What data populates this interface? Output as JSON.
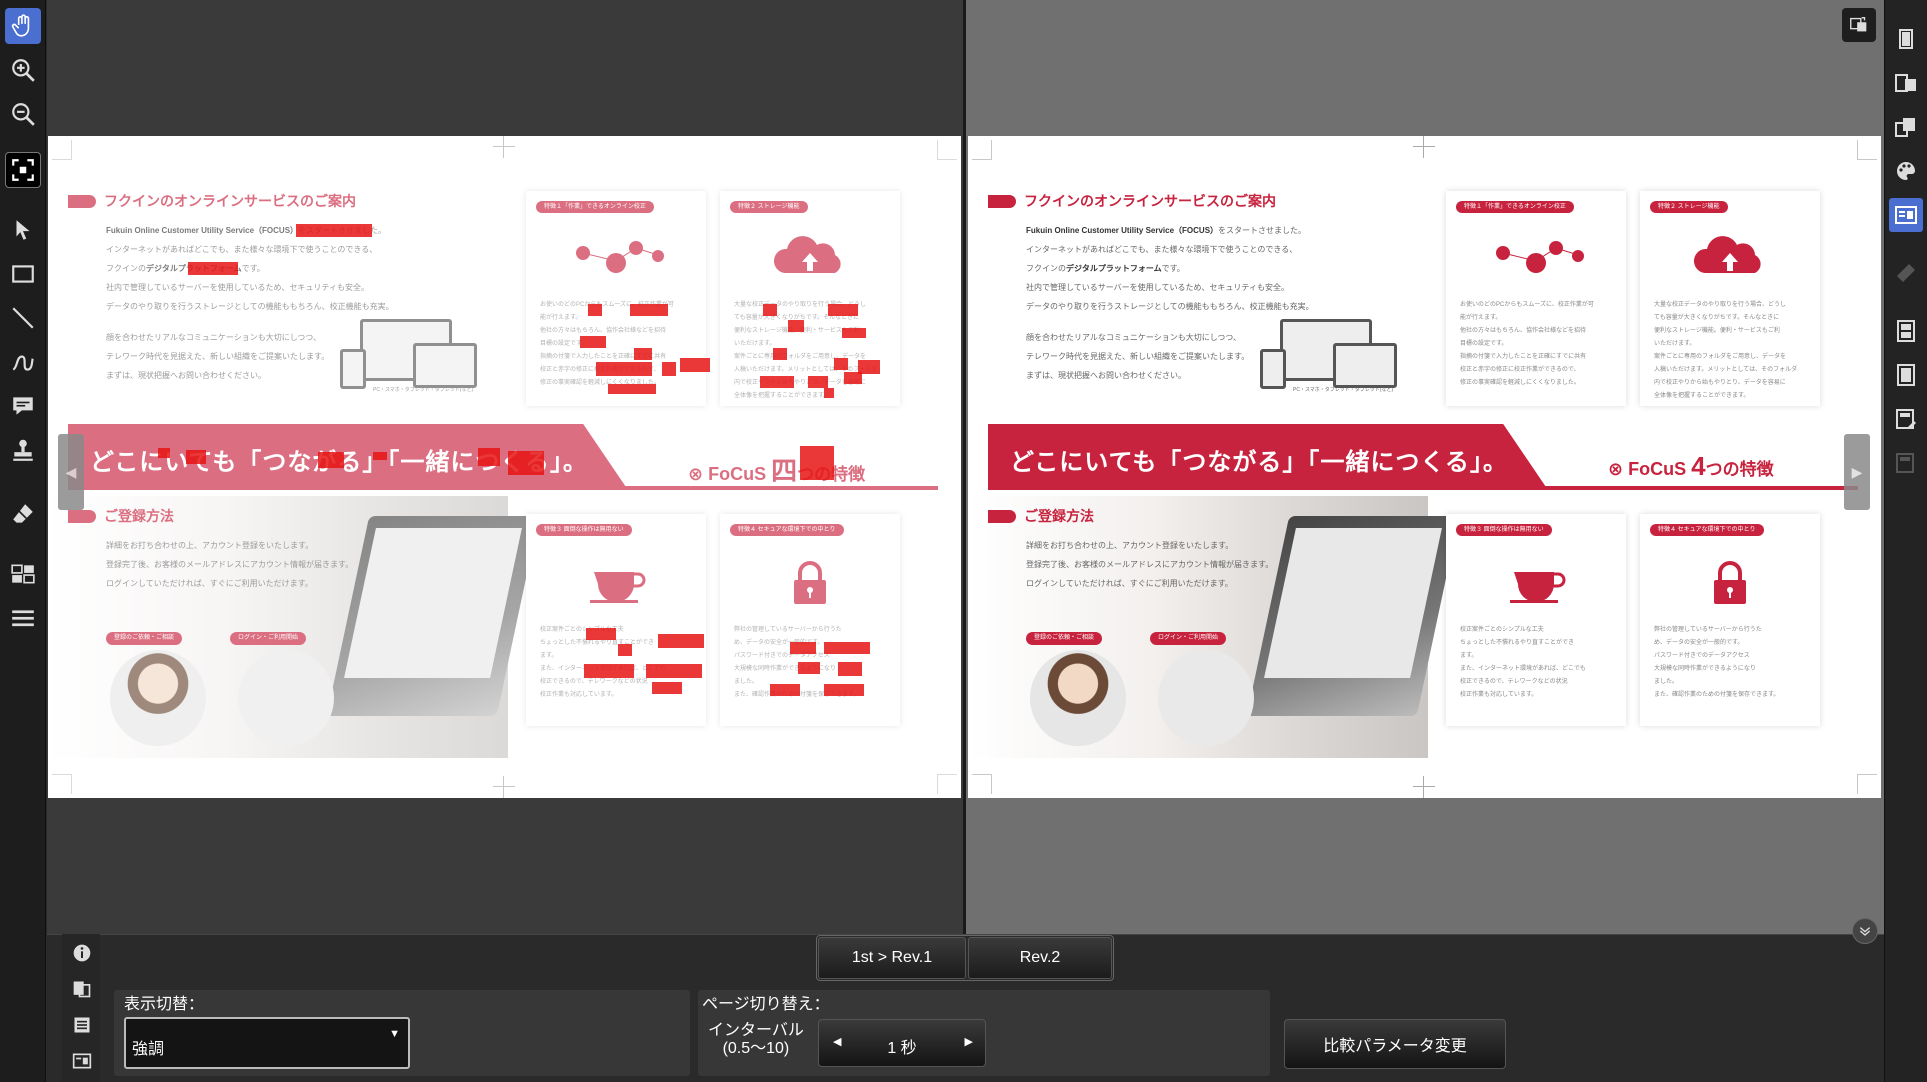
{
  "left_toolbar": {
    "tools": [
      "hand-icon",
      "zoom-in-icon",
      "zoom-out-icon",
      "fit-page-icon",
      "select-arrow-icon",
      "rectangle-icon",
      "line-icon",
      "freehand-icon",
      "comment-icon",
      "stamp-icon",
      "eraser-icon",
      "grid-icon",
      "menu-icon"
    ],
    "active_tool": "hand-icon"
  },
  "document": {
    "section1_title": "フクインのオンラインサービスのご案内",
    "intro_line1_prefix": "Fukuin Online Customer Utility Service（FOCUS）",
    "intro_line1_suffix": "をスタートさせました。",
    "intro_line2": "インターネットがあればどこでも、また様々な環境下で使うことのできる、",
    "intro_line3_prefix": "フクインの",
    "intro_line3_bold": "デジタルプラットフォーム",
    "intro_line3_suffix": "です。",
    "intro_line4": "社内で管理しているサーバーを使用しているため、セキュリティも安全。",
    "intro_line5": "データのやり取りを行うストレージとしての機能ももちろん、校正機能も充実。",
    "intro_line6": "顔を合わせたリアルなコミュニケーションも大切にしつつ、",
    "intro_line7": "テレワーク時代を見据えた、新しい組織をご提案いたします。",
    "intro_line8": "まずは、現状把握へお問い合わせください。",
    "feature1_pill": "特徴１「作業」できるオンライン校正",
    "feature2_pill": "特徴２ ストレージ機能",
    "feature3_pill": "特徴３ 面倒な操作は無用ない",
    "feature4_pill": "特徴４ セキュアな環境下での中とり",
    "feature1_lines": [
      "お使いのどのPCからもスムーズに、校正作業が可",
      "能が行えます。",
      "他社の方々はもちろん、協作会社様などを招待",
      "目標の設定です。",
      "指摘の付箋で入力したことを正確にすでに共有",
      "校正と赤字の修正に校正作業ができるので、",
      "修正の事実確認を軽減しにくくなりました。"
    ],
    "feature2_lines": [
      "大量な校正データのやり取りを行う場合、どうし",
      "ても容量が大きくなりがちです。そんなときに",
      "便利なストレージ機能。便利・サービスもご利",
      "いただけます。",
      "案件ごとに専用のフォルダをご用意し、データを",
      "入稿いただけます。メリットとしては、そのフォルダ",
      "内で校正やりから始もやりとり、データを容易に",
      "全体像を把握することができます。"
    ],
    "feature3_lines": [
      "校正案件ごとのシンプルな工夫",
      "ちょっとした不慣れるやり直すことができ",
      "ます。",
      "また、インターネット環境があれば、どこでも",
      "校正できるので、テレワークなどの状況",
      "校正作業も対応しています。"
    ],
    "feature4_lines": [
      "弊社の管理しているサーバーから行うた",
      "め、データの安全が一般的です。",
      "パスワード付きでのデータアクセス",
      "大規模な同時作業ができるようになり",
      "ました。",
      "また、確認作業のための付箋を保存できます。"
    ],
    "banner_text": "どこにいても「つながる」「一緒につくる」。",
    "logo_text": "FoCuS",
    "logo_number_left": "四",
    "logo_number_right": "4",
    "logo_suffix": "つの特徴",
    "section2_title": "ご登録方法",
    "reg_line1": "詳細をお打ち合わせの上、アカウント登録をいたします。",
    "reg_line2": "登録完了後、お客様のメールアドレスにアカウント情報が届きます。",
    "reg_line3": "ログインしていただければ、すぐにご利用いただけます。",
    "step1_pill": "登録のご依頼・ご相談",
    "step2_pill": "ログイン・ご利用開始",
    "laptop_caption": "PC・スマホ・タブレット・タブレット(など)"
  },
  "right_toolbar": {
    "tools": [
      "single-page-icon",
      "two-page-icon",
      "overlay-page-icon",
      "palette-icon",
      "compare-icon",
      "ruler-icon",
      "film-strip-icon",
      "page-frame-icon",
      "layout-edit-icon",
      "disabled-layout-icon"
    ],
    "active_tool": "compare-icon"
  },
  "bottom": {
    "tabs": [
      "1st > Rev.1",
      "Rev.2"
    ],
    "display_label": "表示切替：",
    "display_value": "強調",
    "page_switch_label": "ページ切り替え：",
    "interval_label_line1": "インターバル",
    "interval_label_line2": "(0.5〜10)",
    "interval_value": "1 秒",
    "param_button": "比較パラメータ変更"
  }
}
